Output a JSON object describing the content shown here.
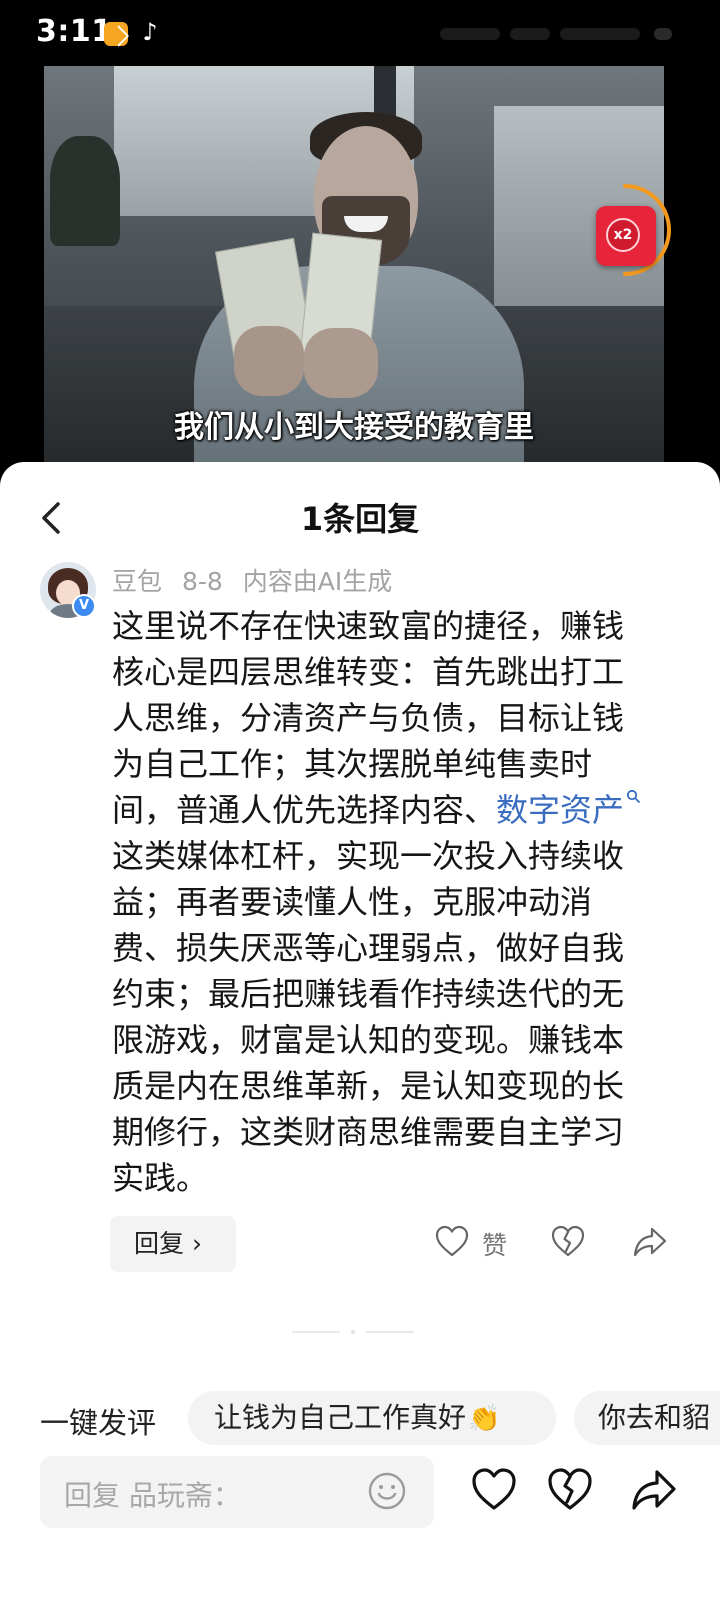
{
  "status_bar": {
    "time": "3:11",
    "app_icons": [
      "notes-app-icon",
      "tiktok-icon"
    ]
  },
  "video": {
    "caption": "我们从小到大接受的教育里",
    "red_packet": {
      "multiplier": "x2",
      "color": "#e8243a",
      "ring_color": "#f39a1e"
    }
  },
  "sheet": {
    "title": "1条回复",
    "comment": {
      "author": "豆包",
      "date": "8-8",
      "ai_note": "内容由AI生成",
      "verified_badge": "V",
      "text_before": "这里说不存在快速致富的捷径，赚钱核心是四层思维转变：首先跳出打工人思维，分清资产与负债，目标让钱为自己工作；其次摆脱单纯售卖时间，普通人优先选择内容、",
      "keyword": "数字资产",
      "text_after": "这类媒体杠杆，实现一次投入持续收益；再者要读懂人性，克服冲动消费、损失厌恶等心理弱点，做好自我约束；最后把赚钱看作持续迭代的无限游戏，财富是认知的变现。赚钱本质是内在思维革新，是认知变现的长期修行，这类财商思维需要自主学习实践。",
      "keyword_color": "#3a6dc0"
    },
    "reply_button": "回复 ›",
    "like_label": "赞"
  },
  "quick_comment": {
    "label": "一键发评",
    "chips": [
      "让钱为自己工作真好",
      "你去和貂"
    ],
    "chip_emoji": "👏"
  },
  "input": {
    "placeholder": "回复 品玩斋："
  }
}
